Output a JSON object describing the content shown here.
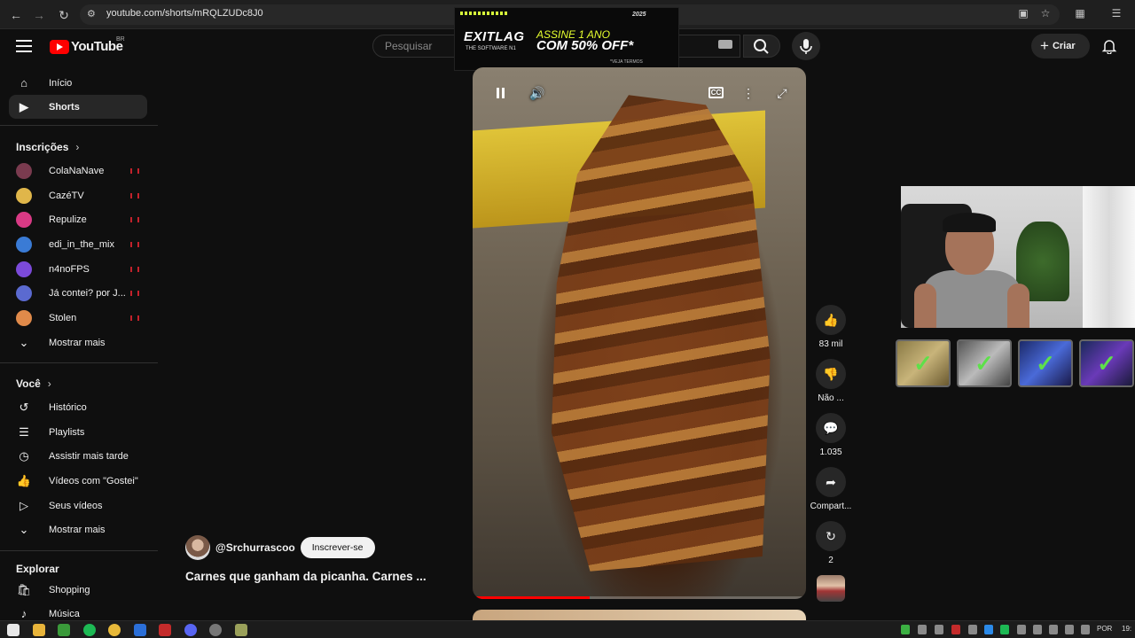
{
  "browser": {
    "url": "youtube.com/shorts/mRQLZUDc8J0",
    "back_icon": "arrow-left-icon",
    "forward_icon": "arrow-right-icon",
    "reload_icon": "reload-icon"
  },
  "ad": {
    "brand": "EXITLAG",
    "brand_sub": "THE SOFTWARE N1",
    "headline1": "ASSINE 1 ANO",
    "headline2": "COM 50% OFF*",
    "terms": "*VEJA TERMOS",
    "year": "2025",
    "accent_color": "#e6ff2e"
  },
  "header": {
    "logo_text": "YouTube",
    "country_code": "BR",
    "search_placeholder": "Pesquisar",
    "create_label": "Criar"
  },
  "sidebar": {
    "main": [
      {
        "label": "Início",
        "icon": "home-icon"
      },
      {
        "label": "Shorts",
        "icon": "shorts-icon",
        "active": true
      }
    ],
    "subscriptions_title": "Inscrições",
    "subscriptions": [
      {
        "label": "ColaNaNave",
        "live": true,
        "color": "#7a3b4f"
      },
      {
        "label": "CazéTV",
        "live": true,
        "color": "#e0b64a"
      },
      {
        "label": "Repulize",
        "live": true,
        "color": "#d93a85"
      },
      {
        "label": "edi_in_the_mix",
        "live": true,
        "color": "#3a7bd5"
      },
      {
        "label": "n4noFPS",
        "live": true,
        "color": "#7b4ad9"
      },
      {
        "label": "Já contei? por J...",
        "live": true,
        "color": "#5b6ad0"
      },
      {
        "label": "Stolen",
        "live": true,
        "color": "#e08a4a"
      }
    ],
    "show_more_label": "Mostrar mais",
    "you_title": "Você",
    "you_items": [
      {
        "label": "Histórico",
        "icon": "history-icon"
      },
      {
        "label": "Playlists",
        "icon": "playlists-icon"
      },
      {
        "label": "Assistir mais tarde",
        "icon": "clock-icon"
      },
      {
        "label": "Vídeos com \"Gostei\"",
        "icon": "like-icon"
      },
      {
        "label": "Seus vídeos",
        "icon": "video-icon"
      }
    ],
    "show_more_label_2": "Mostrar mais",
    "explore_title": "Explorar",
    "explore_items": [
      {
        "label": "Shopping",
        "icon": "bag-icon"
      },
      {
        "label": "Música",
        "icon": "music-icon"
      }
    ]
  },
  "short": {
    "channel_handle": "@Srchurrascoo",
    "subscribe_label": "Inscrever-se",
    "title": "Carnes que ganham da picanha. Carnes ...",
    "progress": 0.35,
    "likes": "83 mil",
    "dislike_label": "Não ...",
    "comments": "1.035",
    "share_label": "Compart...",
    "remix_count": "2"
  },
  "taskbar": {
    "language": "POR",
    "time": "19:"
  }
}
